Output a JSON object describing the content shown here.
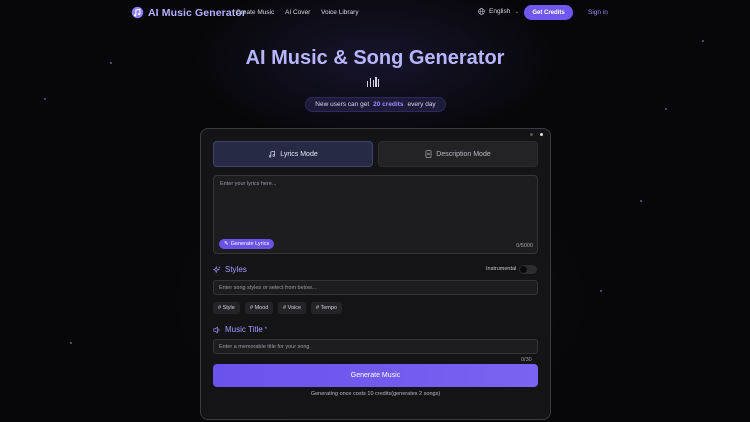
{
  "nav": {
    "logo_text": "AI Music Generator",
    "links": [
      "Create Music",
      "AI Cover",
      "Voice Library"
    ],
    "language": "English",
    "credits_button": "Get Credits",
    "sign_in": "Sign in"
  },
  "hero": {
    "title": "AI Music & Song Generator",
    "promo_prefix": "New users can get",
    "promo_highlight": "20 credits",
    "promo_suffix": "every day"
  },
  "tabs": {
    "lyrics_mode": "Lyrics Mode",
    "description_mode": "Description Mode"
  },
  "lyrics": {
    "placeholder": "Enter your lyrics here...",
    "generate_button": "Generate Lyrics",
    "count": "0/5000"
  },
  "styles": {
    "title": "Styles",
    "instrumental_label": "Instrumental",
    "instrumental_on": false,
    "placeholder": "Enter song styles or select from below...",
    "chips": [
      "# Style",
      "# Mood",
      "# Voice",
      "# Tempo"
    ]
  },
  "music_title": {
    "title": "Music Title",
    "required_mark": "*",
    "placeholder": "Enter a memorable title for your song",
    "count": "0/30"
  },
  "generate": {
    "button": "Generate Music",
    "note": "Generating once costs 10 credits(generates 2 songs)"
  },
  "colors": {
    "accent": "#6f57f0",
    "title": "#b7b5ff",
    "background": "#07070a"
  }
}
